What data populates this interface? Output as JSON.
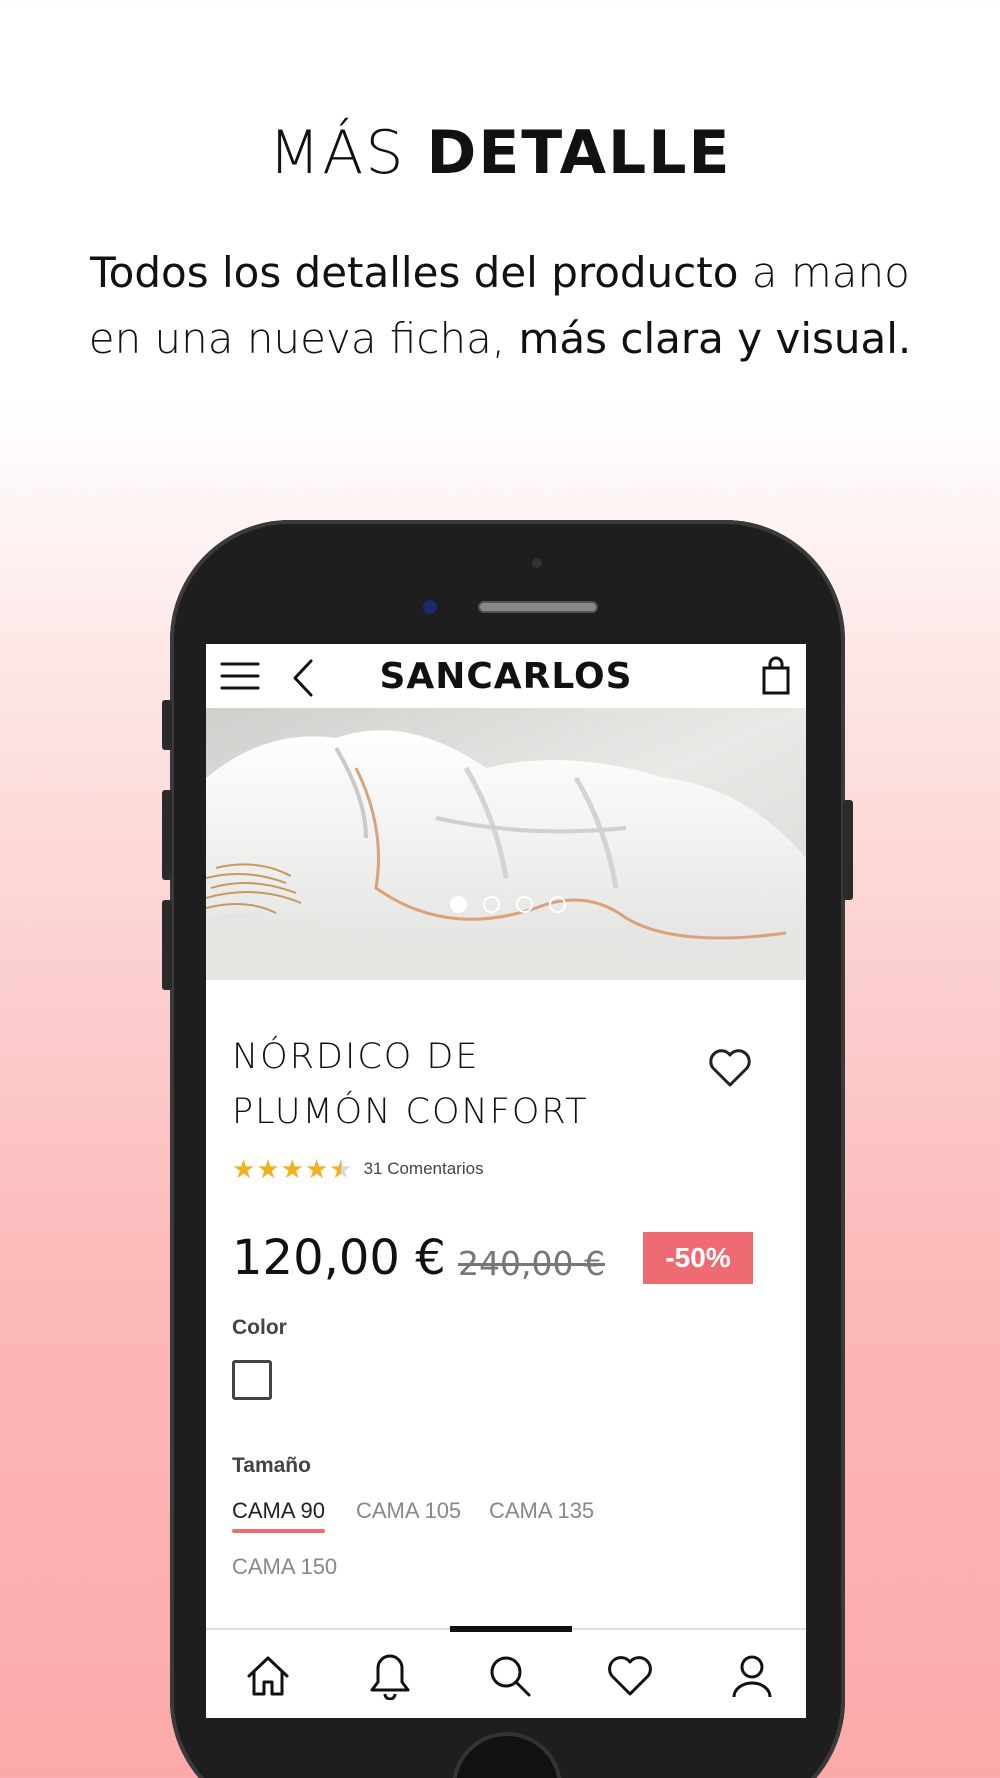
{
  "promo": {
    "headline_light": "MÁS",
    "headline_bold": "DETALLE",
    "sub_bold_1": "Todos los detalles del producto",
    "sub_light_1": " a mano",
    "sub_light_2": "en una nueva ficha, ",
    "sub_bold_2": "más clara y visual."
  },
  "app": {
    "brand": "SANCARLOS",
    "icons": [
      "menu-icon",
      "back-icon",
      "bag-icon"
    ]
  },
  "gallery": {
    "total_images": 4,
    "active_index": 0
  },
  "product": {
    "title_line1": "NÓRDICO DE",
    "title_line2": "PLUMÓN CONFORT",
    "rating": 4.5,
    "rating_max": 5,
    "comments": "31 Comentarios",
    "price": "120,00 €",
    "old_price": "240,00 €",
    "discount": "-50%"
  },
  "options": {
    "color_label": "Color",
    "size_label": "Tamaño",
    "sizes": [
      "CAMA 90",
      "CAMA 105",
      "CAMA 135",
      "CAMA 150"
    ],
    "selected_size": "CAMA 90"
  },
  "bottom_nav": {
    "items": [
      "home-icon",
      "bell-icon",
      "search-icon",
      "heart-icon",
      "user-icon"
    ],
    "active": "search-icon"
  },
  "colors": {
    "accent": "#ef6b73",
    "star": "#f2b01e"
  }
}
